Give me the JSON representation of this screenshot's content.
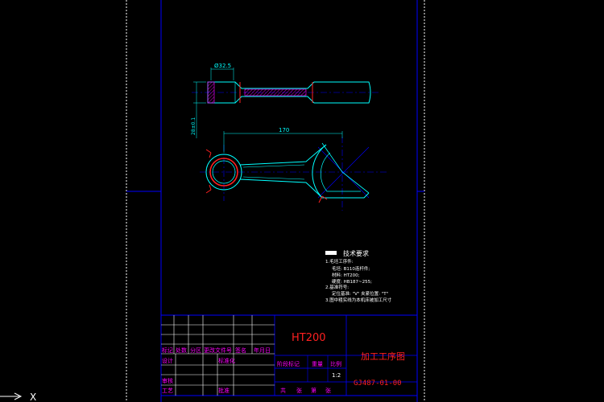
{
  "drawing": {
    "dimensions": {
      "width_top": "Ø32.5",
      "height_left": "28±0.1",
      "length": "170"
    },
    "technical_requirements": {
      "title": "技术要求",
      "lines": [
        "1.毛坯工序件:",
        "毛坯: B110连杆件;",
        "材料: HT200;",
        "硬度: HB187~255;",
        "2.基准符号:",
        "定位基准: \"V\" 夹紧位置: \"T\"",
        "3.图中粗实线为本机床被加工尺寸"
      ]
    },
    "title_block": {
      "material": "HT200",
      "drawing_name": "加工工序图",
      "drawing_number": "GJ487-01-00",
      "scale_label": "比例",
      "scale_value": "1:2",
      "weight_label": "重量",
      "stage_label": "阶段标记",
      "sheet_labels": [
        "共",
        "张",
        "第",
        "张"
      ],
      "rev_headers": [
        "标记",
        "处数",
        "分区",
        "更改文件号",
        "签名",
        "年月日"
      ],
      "roles": [
        "设计",
        "标准化",
        "审核",
        "工艺",
        "批准"
      ]
    },
    "colors": {
      "border": "#0000ff",
      "outline": "#00ffff",
      "center": "#0000ff",
      "hatch": "#ff00ff",
      "section": "#ff2020",
      "text": "#ffffff",
      "title": "#ff00ff"
    }
  },
  "cad": {
    "crosshair_x_label": "X"
  }
}
